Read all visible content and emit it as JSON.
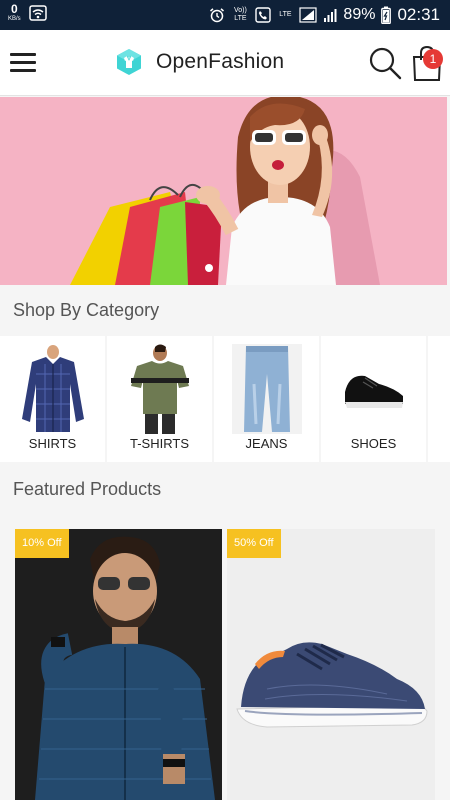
{
  "status_bar": {
    "net_speed": "0",
    "net_unit": "KB/s",
    "volte": "Vo)) LTE",
    "lte": "LTE",
    "battery": "89%",
    "time": "02:31"
  },
  "app_bar": {
    "brand_name": "OpenFashion",
    "cart_count": "1"
  },
  "banner": {
    "slide_count": 1
  },
  "categories_section": {
    "title": "Shop By Category",
    "items": [
      {
        "label": "SHIRTS"
      },
      {
        "label": "T-SHIRTS"
      },
      {
        "label": "JEANS"
      },
      {
        "label": "SHOES"
      }
    ]
  },
  "featured_section": {
    "title": "Featured Products",
    "products": [
      {
        "discount": "10% Off"
      },
      {
        "discount": "50% Off"
      }
    ]
  },
  "colors": {
    "status_bar_bg": "#0f2138",
    "badge": "#f6c121",
    "cart_badge": "#e53935",
    "banner_bg": "#f5b3c4"
  }
}
